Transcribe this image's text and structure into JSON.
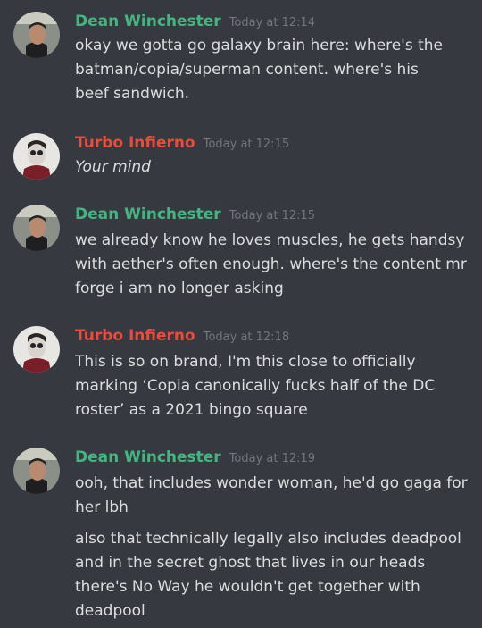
{
  "colors": {
    "background": "#36393f",
    "dean": "#43b581",
    "turbo": "#e74c3c",
    "timestamp": "#72767d",
    "text": "#dcddde"
  },
  "messages": [
    {
      "author": "Dean Winchester",
      "time": "Today at 12:14",
      "lines": [
        "okay we gotta go galaxy brain here: where's the",
        "batman/copia/superman content. where's his",
        "beef sandwich."
      ]
    },
    {
      "author": "Turbo Infierno",
      "time": "Today at 12:15",
      "lines": [
        "Your mind"
      ]
    },
    {
      "author": "Dean Winchester",
      "time": "Today at 12:15",
      "lines": [
        "we already know he loves muscles, he gets handsy",
        "with aether's often enough. where's the content mr",
        "forge i am no longer asking"
      ]
    },
    {
      "author": "Turbo Infierno",
      "time": "Today at 12:18",
      "lines": [
        "This is so on brand, I'm this close to officially",
        "marking ‘Copia canonically fucks half of the DC",
        "roster’ as a 2021 bingo square"
      ]
    },
    {
      "author": "Dean Winchester",
      "time": "Today at 12:19",
      "lines": [
        "ooh, that includes wonder woman, he'd go gaga for",
        "her lbh"
      ],
      "followup": [
        "also that technically legally also includes deadpool",
        "and in the secret ghost that lives in our heads",
        "there's No Way he wouldn't get together with",
        "deadpool"
      ]
    }
  ]
}
